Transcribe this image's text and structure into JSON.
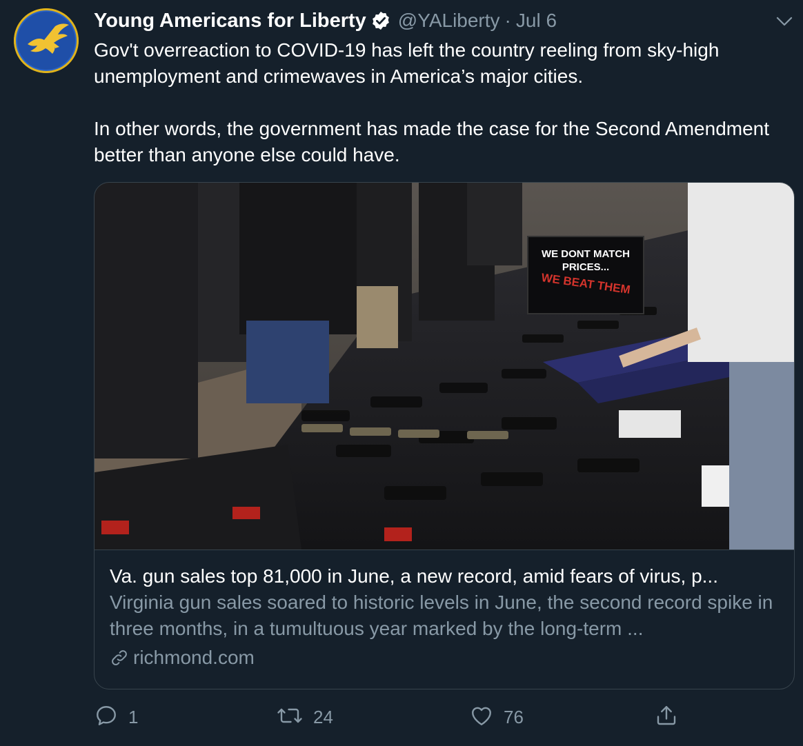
{
  "account": {
    "display_name": "Young Americans for Liberty",
    "handle": "@YALiberty",
    "separator": "·",
    "date": "Jul 6",
    "avatar_icon": "eagle-logo",
    "verified_icon": "verified-badge-icon"
  },
  "tweet": {
    "paragraphs": [
      "Gov't overreaction to COVID-19 has left the country reeling from sky-high unemployment and crimewaves in America’s major cities.",
      "In other words, the government has made the case for the Second Amendment better than anyone else could have."
    ]
  },
  "card": {
    "image_sign": {
      "line1": "WE DONT MATCH",
      "line2": "PRICES...",
      "line3": "WE BEAT THEM"
    },
    "title": "Va. gun sales top 81,000 in June, a new record, amid fears of virus, p...",
    "description": "Virginia gun sales soared to historic levels in June, the second record spike in three months, in a tumultuous year marked by the long-term ...",
    "domain": "richmond.com",
    "domain_icon": "link-icon"
  },
  "actions": {
    "reply": {
      "icon": "reply-icon",
      "count": "1"
    },
    "retweet": {
      "icon": "retweet-icon",
      "count": "24"
    },
    "like": {
      "icon": "heart-icon",
      "count": "76"
    },
    "share": {
      "icon": "share-icon"
    }
  },
  "colors": {
    "background": "#15202b",
    "text": "#ffffff",
    "secondary": "#8899a6",
    "border": "#38444d"
  }
}
